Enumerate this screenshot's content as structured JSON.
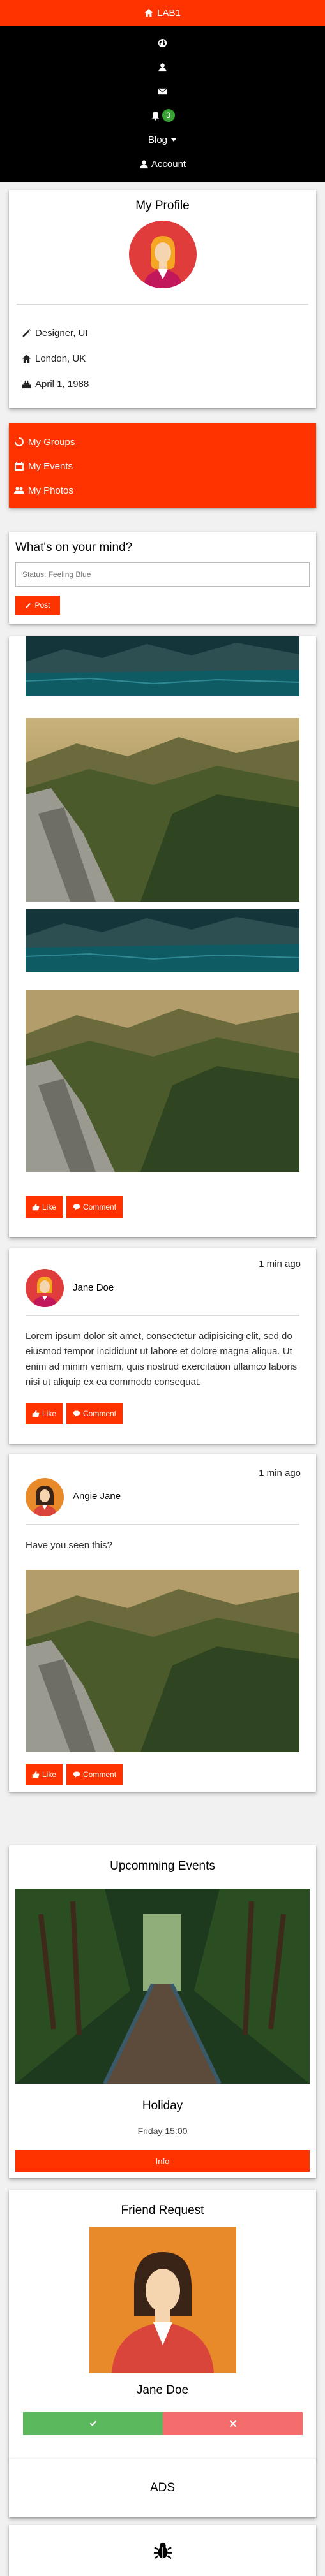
{
  "colors": {
    "accent": "#ff3300",
    "nav_bg": "#000000",
    "success": "#5cb85c",
    "danger": "#f56c6c",
    "badge": "#3aa335"
  },
  "topbar": {
    "brand": "LAB1",
    "icon": "home-icon"
  },
  "nav": {
    "items": [
      {
        "icon": "globe-icon"
      },
      {
        "icon": "user-icon"
      },
      {
        "icon": "envelope-icon"
      },
      {
        "icon": "bell-icon",
        "badge": "3"
      },
      {
        "label": "Blog",
        "icon": "caret-down-icon"
      },
      {
        "label": "Account",
        "icon": "user-icon"
      }
    ]
  },
  "profile": {
    "title": "My Profile",
    "job": "Designer, UI",
    "location": "London, UK",
    "birthday": "April 1, 1988"
  },
  "links": {
    "groups": "My Groups",
    "events": "My Events",
    "photos": "My Photos"
  },
  "composer": {
    "prompt": "What's on your mind?",
    "placeholder": "Status: Feeling Blue",
    "post_label": "Post"
  },
  "actions": {
    "like": "Like",
    "comment": "Comment"
  },
  "posts": [
    {
      "author": "Jane Doe",
      "time": "1 min ago",
      "text": "Lorem ipsum dolor sit amet, consectetur adipisicing elit, sed do eiusmod tempor incididunt ut labore et dolore magna aliqua. Ut enim ad minim veniam, quis nostrud exercitation ullamco laboris nisi ut aliquip ex ea commodo consequat."
    },
    {
      "author": "Angie Jane",
      "time": "1 min ago",
      "text": "Have you seen this?"
    }
  ],
  "events": {
    "title": "Upcomming Events",
    "name": "Holiday",
    "date": "Friday 15:00",
    "button": "Info"
  },
  "friend_request": {
    "title": "Friend Request",
    "name": "Jane Doe"
  },
  "ads": {
    "label": "ADS"
  }
}
